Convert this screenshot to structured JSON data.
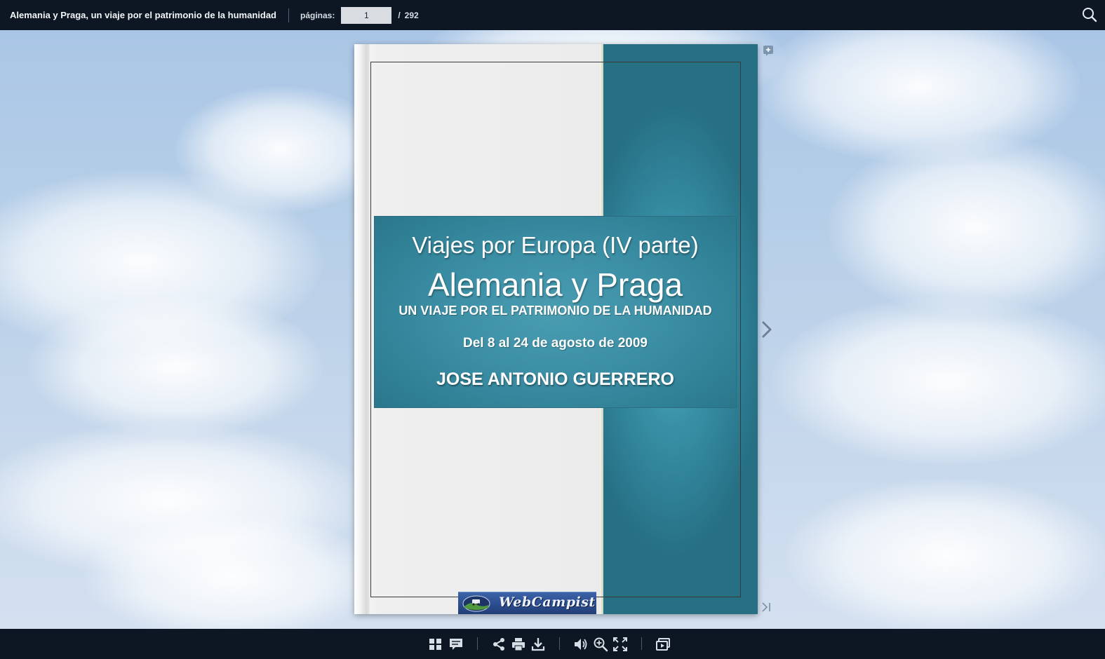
{
  "header": {
    "title": "Alemania y Praga, un viaje por el patrimonio de la humanidad",
    "pages_label": "páginas:",
    "current_page": "1",
    "page_separator": "/",
    "total_pages": "292"
  },
  "cover": {
    "series": "Viajes por Europa (IV parte)",
    "title": "Alemania y Praga",
    "subtitle": "UN VIAJE POR EL PATRIMONIO DE LA HUMANIDAD",
    "dates": "Del 8 al 24 de agosto de 2009",
    "author": "JOSE ANTONIO GUERRERO",
    "logo_text": "WebCampist"
  },
  "colors": {
    "bar_background": "#0c1723",
    "teal": "#3a8fa5",
    "sky": "#b7cfe8"
  },
  "icons": {
    "search": "search-icon",
    "add_note": "plus-icon",
    "next": "chevron-right-icon",
    "last": "last-page-icon",
    "toolbar": [
      "thumbnails-icon",
      "comments-icon",
      "share-icon",
      "print-icon",
      "download-icon",
      "sound-icon",
      "zoom-in-icon",
      "fullscreen-icon",
      "slideshow-icon"
    ]
  }
}
